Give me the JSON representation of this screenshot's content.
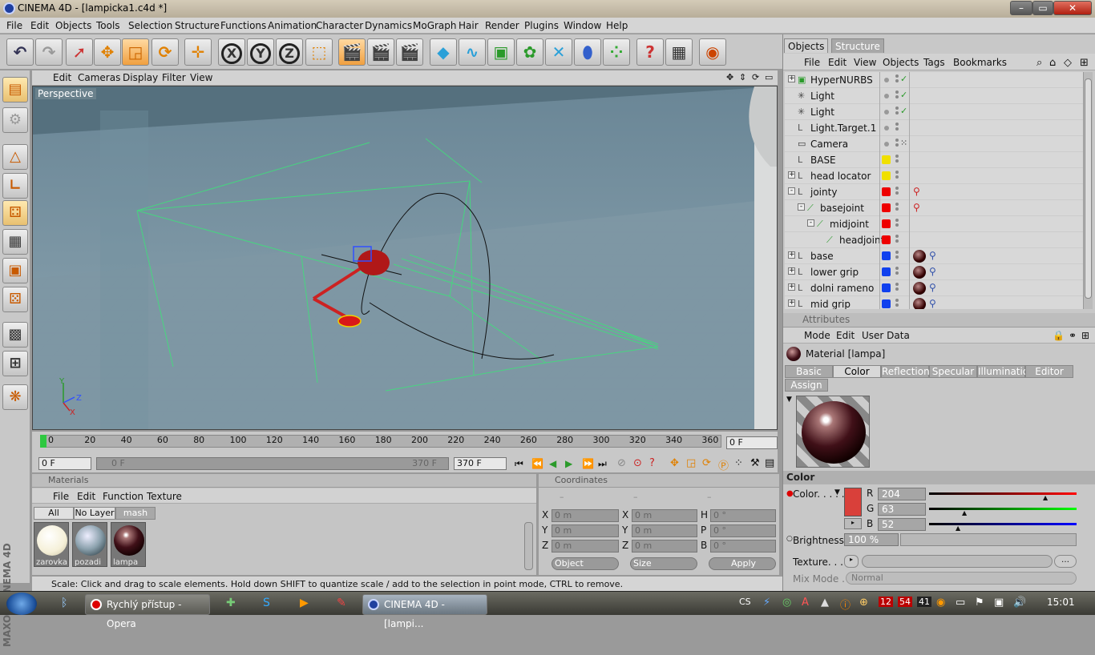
{
  "window": {
    "title": "CINEMA 4D - [lampicka1.c4d *]",
    "min": "–",
    "max": "▭",
    "close": "✕"
  },
  "menu": [
    "File",
    "Edit",
    "Objects",
    "Tools",
    "Selection",
    "Structure",
    "Functions",
    "Animation",
    "Character",
    "Dynamics",
    "MoGraph",
    "Hair",
    "Render",
    "Plugins",
    "Window",
    "Help"
  ],
  "toolbar": {
    "x": "X",
    "y": "Y",
    "z": "Z"
  },
  "viewport": {
    "menu": [
      "Edit",
      "Cameras",
      "Display",
      "Filter",
      "View"
    ],
    "label": "Perspective",
    "axis_y": "Y",
    "axis_z": "Z",
    "axis_x": "X"
  },
  "timeline": {
    "ticks": [
      "0",
      "20",
      "40",
      "60",
      "80",
      "100",
      "120",
      "140",
      "160",
      "180",
      "200",
      "220",
      "240",
      "260",
      "280",
      "300",
      "320",
      "340",
      "360"
    ],
    "current": "0 F",
    "start": "0 F",
    "range_start": "0 F",
    "range_end": "370 F",
    "end": "370 F"
  },
  "materials": {
    "header": "Materials",
    "menu": [
      "File",
      "Edit",
      "Function",
      "Texture"
    ],
    "filters": [
      "All",
      "No Layer",
      "mash"
    ],
    "items": [
      "zarovka",
      "pozadi",
      "lampa"
    ]
  },
  "coordinates": {
    "header": "Coordinates",
    "col_dashes": [
      "–",
      "–",
      "–"
    ],
    "rows": [
      {
        "a": "X",
        "av": "0 m",
        "b": "X",
        "bv": "0 m",
        "c": "H",
        "cv": "0 °"
      },
      {
        "a": "Y",
        "av": "0 m",
        "b": "Y",
        "bv": "0 m",
        "c": "P",
        "cv": "0 °"
      },
      {
        "a": "Z",
        "av": "0 m",
        "b": "Z",
        "bv": "0 m",
        "c": "B",
        "cv": "0 °"
      }
    ],
    "mode": "Object",
    "size": "Size",
    "apply": "Apply"
  },
  "status": "Scale: Click and drag to scale elements. Hold down SHIFT to quantize scale / add to the selection in point mode, CTRL to remove.",
  "objects_panel": {
    "tabs": [
      "Objects",
      "Structure"
    ],
    "menu": [
      "File",
      "Edit",
      "View",
      "Objects",
      "Tags",
      "Bookmarks"
    ],
    "items": [
      {
        "name": "HyperNURBS",
        "indent": 0,
        "expand": "+",
        "layer": "",
        "check": "✓"
      },
      {
        "name": "Light",
        "indent": 0,
        "expand": "",
        "layer": "",
        "check": "✓"
      },
      {
        "name": "Light",
        "indent": 0,
        "expand": "",
        "layer": "",
        "check": "✓"
      },
      {
        "name": "Light.Target.1",
        "indent": 0,
        "expand": "",
        "layer": "",
        "check": ""
      },
      {
        "name": "Camera",
        "indent": 0,
        "expand": "",
        "layer": "",
        "check": ""
      },
      {
        "name": "BASE",
        "indent": 0,
        "expand": "",
        "layer": "#f0e000",
        "check": ""
      },
      {
        "name": "head locator",
        "indent": 0,
        "expand": "+",
        "layer": "#f0e000",
        "check": ""
      },
      {
        "name": "jointy",
        "indent": 0,
        "expand": "-",
        "layer": "#ee0000",
        "check": ""
      },
      {
        "name": "basejoint",
        "indent": 1,
        "expand": "-",
        "layer": "#ee0000",
        "check": ""
      },
      {
        "name": "midjoint",
        "indent": 2,
        "expand": "-",
        "layer": "#ee0000",
        "check": ""
      },
      {
        "name": "headjoint",
        "indent": 3,
        "expand": "",
        "layer": "#ee0000",
        "check": ""
      },
      {
        "name": "base",
        "indent": 0,
        "expand": "+",
        "layer": "#1040ee",
        "check": ""
      },
      {
        "name": "lower grip",
        "indent": 0,
        "expand": "+",
        "layer": "#1040ee",
        "check": ""
      },
      {
        "name": "dolni rameno",
        "indent": 0,
        "expand": "+",
        "layer": "#1040ee",
        "check": ""
      },
      {
        "name": "mid grip",
        "indent": 0,
        "expand": "+",
        "layer": "#1040ee",
        "check": ""
      }
    ]
  },
  "attributes": {
    "header": "Attributes",
    "menu": [
      "Mode",
      "Edit",
      "User Data"
    ],
    "material": "Material [lampa]",
    "tabs": [
      "Basic",
      "Color",
      "Reflection",
      "Specular",
      "Illumination",
      "Editor",
      "Assign"
    ],
    "active_tab": "Color",
    "section": "Color",
    "color_label": "Color. . . . .",
    "swatch": "#d9403a",
    "r_label": "R",
    "r": "204",
    "g_label": "G",
    "g": "63",
    "b_label": "B",
    "b": "52",
    "brightness_label": "Brightness",
    "brightness": "100 %",
    "texture_label": "Texture. . . . .",
    "mixmode_label": "Mix Mode . .",
    "mixmode": "Normal"
  },
  "taskbar": {
    "tasks": [
      "Rychlý přístup - Opera",
      "CINEMA 4D - [lampi..."
    ],
    "lang": "CS",
    "badges": [
      "12",
      "54",
      "41"
    ],
    "clock": "15:01"
  },
  "branding": "MAXON CINEMA 4D"
}
